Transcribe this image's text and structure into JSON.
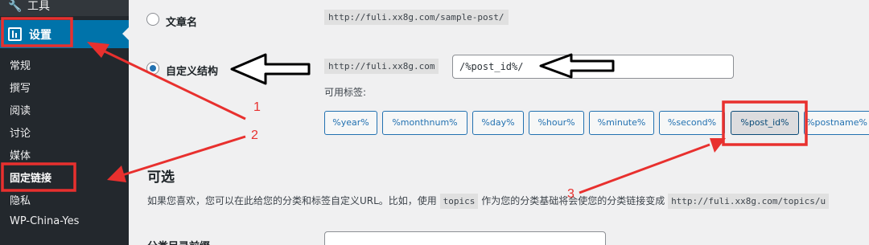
{
  "sidebar": {
    "tools_label": "工具",
    "settings_label": "设置",
    "sub_items": [
      {
        "label": "常规"
      },
      {
        "label": "撰写"
      },
      {
        "label": "阅读"
      },
      {
        "label": "讨论"
      },
      {
        "label": "媒体"
      },
      {
        "label": "固定链接"
      },
      {
        "label": "隐私"
      },
      {
        "label": "WP-China-Yes"
      }
    ]
  },
  "permalink": {
    "post_name_label": "文章名",
    "post_name_example": "http://fuli.xx8g.com/sample-post/",
    "custom_label": "自定义结构",
    "custom_prefix": "http://fuli.xx8g.com",
    "custom_value": "/%post_id%/",
    "available_tags_label": "可用标签:",
    "tags": [
      "%year%",
      "%monthnum%",
      "%day%",
      "%hour%",
      "%minute%",
      "%second%",
      "%post_id%",
      "%postname%"
    ],
    "active_tag": "%post_id%"
  },
  "optional": {
    "title": "可选",
    "desc_part1": "如果您喜欢，您可以在此给您的分类和标签自定义URL。比如，使用",
    "desc_code": "topics",
    "desc_part2": "作为您的分类基础将会使您的分类链接变成",
    "desc_url": "http://fuli.xx8g.com/topics/u",
    "category_base_label": "分类目录前缀"
  },
  "annotations": {
    "labels": [
      "1",
      "2",
      "3"
    ],
    "color": "#e8302e"
  },
  "colors": {
    "sidebar_bg": "#23282d",
    "accent": "#0073aa",
    "page_bg": "#f0f0f1",
    "annotation": "#e8302e"
  }
}
